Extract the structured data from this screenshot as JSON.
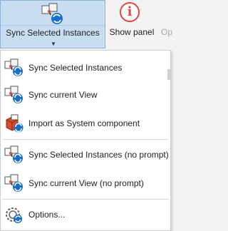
{
  "ribbon": {
    "sync_button": {
      "label": "Sync Selected Instances",
      "icon": "sync-instances-icon"
    },
    "show_panel": {
      "label": "Show panel",
      "icon": "info-icon",
      "glyph": "i"
    },
    "truncated_label": "Op"
  },
  "menu": {
    "items": [
      {
        "label": "Sync Selected Instances",
        "icon": "sync-instances-icon"
      },
      {
        "label": "Sync current View",
        "icon": "sync-view-icon"
      },
      {
        "label": "Import as System component",
        "icon": "import-component-icon"
      },
      {
        "label": "Sync Selected Instances (no prompt)",
        "icon": "sync-instances-icon"
      },
      {
        "label": "Sync current View (no prompt)",
        "icon": "sync-view-icon"
      },
      {
        "label": "Options...",
        "icon": "options-gear-icon"
      }
    ]
  },
  "colors": {
    "selected_bg": "#c8ddf1",
    "selected_border": "#8db3d9",
    "accent_blue": "#1a6ec8",
    "accent_red": "#e04a3f"
  }
}
